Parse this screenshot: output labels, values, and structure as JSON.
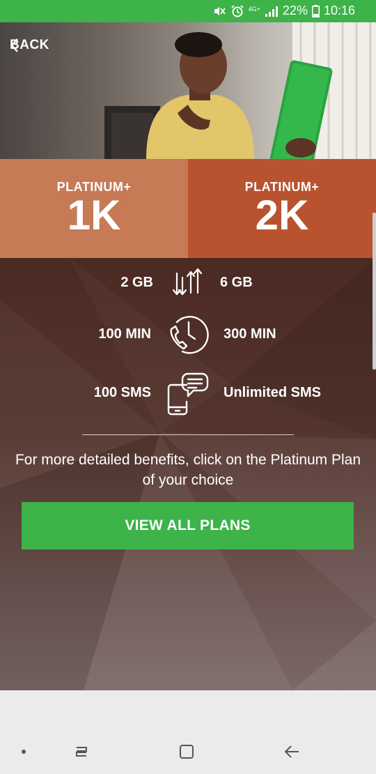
{
  "status_bar": {
    "battery": "22%",
    "time": "10:16",
    "network": "4G+"
  },
  "header": {
    "back_label": "BACK"
  },
  "plans": [
    {
      "name": "PLATINUM+",
      "size": "1K"
    },
    {
      "name": "PLATINUM+",
      "size": "2K"
    }
  ],
  "benefits": [
    {
      "icon": "data-transfer-icon",
      "left": "2 GB",
      "right": "6 GB"
    },
    {
      "icon": "clock-phone-icon",
      "left": "100 MIN",
      "right": "300 MIN"
    },
    {
      "icon": "phone-message-icon",
      "left": "100 SMS",
      "right": "Unlimited SMS"
    }
  ],
  "info_text": "For more detailed benefits, click on the Platinum Plan of your choice",
  "cta_label": "VIEW ALL PLANS",
  "colors": {
    "brand_green": "#3db34a",
    "tab_1": "#c67a55",
    "tab_2": "#b9532f"
  }
}
